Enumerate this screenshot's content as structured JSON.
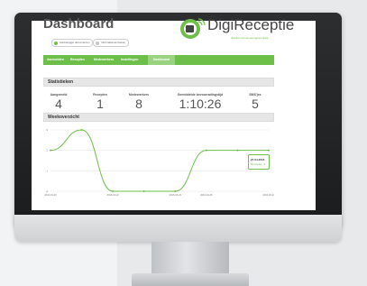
{
  "dashboard": {
    "title": "Dashboard",
    "chips": [
      {
        "label": "Aanhangige documenten",
        "color": "#6dbf4a"
      },
      {
        "label": "Informatieverzoeken",
        "color": "#c8c8c8"
      }
    ]
  },
  "brand": {
    "name": "DigiReceptie",
    "tagline": "digitale fotovervoeringscentrale",
    "accent": "#6dbf4a"
  },
  "nav": {
    "items": [
      "Aanmelden",
      "Recepten",
      "Medewerkers",
      "Instellingen",
      "Dashboard"
    ],
    "active_index": 4
  },
  "statistics": {
    "header": "Statistieken",
    "items": [
      {
        "label": "Aangemeld",
        "value": "4"
      },
      {
        "label": "Recepten",
        "value": "1"
      },
      {
        "label": "Medewerkers",
        "value": "8"
      },
      {
        "label": "Gemiddelde bevoorradingstijd",
        "value": "1:10:26"
      },
      {
        "label": "SMS'jes",
        "value": "5"
      }
    ]
  },
  "weekly": {
    "header": "Weekoverzicht",
    "tooltip": {
      "line1": "27-04-2016",
      "line2": "Recepten: 2"
    }
  },
  "chart_data": {
    "type": "line",
    "x": [
      "2016-04-20",
      "2016-04-21",
      "2016-04-22",
      "2016-04-23",
      "2016-04-24",
      "2016-04-25",
      "2016-04-26",
      "2016-04-27"
    ],
    "ticks_x": [
      "2016-04-20",
      "2016-04-22",
      "2016-04-24",
      "2016-04-25",
      "2016-04-27"
    ],
    "yticks": [
      0,
      1,
      2,
      3
    ],
    "series": [
      {
        "values": [
          2,
          3,
          0,
          0,
          0,
          2,
          2,
          2
        ]
      }
    ],
    "ylim": [
      0,
      3
    ],
    "grid": true,
    "color": "#6dbf4a"
  }
}
